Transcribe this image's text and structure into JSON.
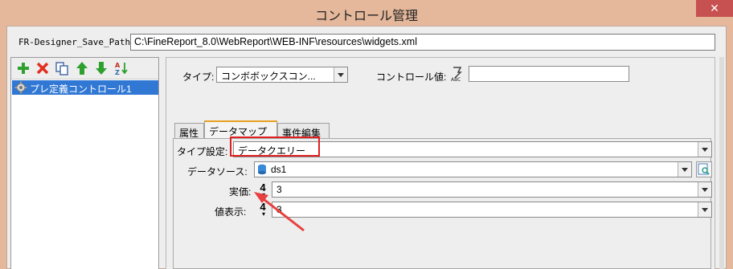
{
  "window": {
    "title": "コントロール管理",
    "close_label": "✕"
  },
  "path": {
    "label": "FR-Designer_Save_Path:",
    "value": "C:\\FineReport_8.0\\WebReport\\WEB-INF\\resources\\widgets.xml"
  },
  "toolbar": {
    "items": [
      {
        "name": "add-icon",
        "color": "#2ea02e"
      },
      {
        "name": "delete-icon",
        "color": "#e03020"
      },
      {
        "name": "copy-icon",
        "color": "#4a6ea8"
      },
      {
        "name": "move-up-icon",
        "color": "#2ea02e"
      },
      {
        "name": "move-down-icon",
        "color": "#2ea02e"
      },
      {
        "name": "sort-az-icon",
        "color": "#c03020"
      }
    ]
  },
  "tree": {
    "items": [
      {
        "label": "プレ定義コントロール1",
        "icon": "gear-icon"
      }
    ]
  },
  "form": {
    "type_label": "タイプ:",
    "type_value": "コンボボックスコン...",
    "control_value_label": "コントロール値:",
    "control_value": ""
  },
  "tabs": [
    {
      "label": "属性"
    },
    {
      "label": "データマップ"
    },
    {
      "label": "事件編集"
    }
  ],
  "datamap": {
    "type_setting_label": "タイプ設定:",
    "type_setting_value": "データクエリー",
    "data_source_label": "データソース:",
    "data_source_value": "ds1",
    "actual_label": "実価:",
    "actual_value": "3",
    "display_label": "値表示:",
    "display_value": "3",
    "number_icon_glyph": "4"
  },
  "colors": {
    "highlight": "#e02020",
    "selection": "#3178d4",
    "title_bar": "#e5b89c"
  }
}
